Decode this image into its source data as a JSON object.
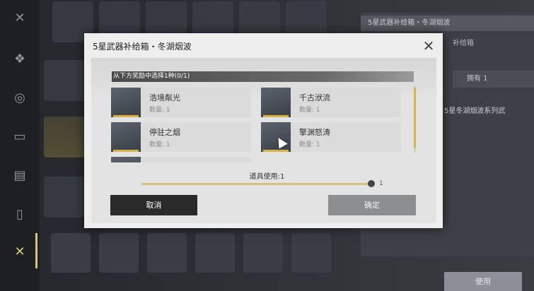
{
  "background": {
    "sidebar_icons": [
      "close-icon",
      "badge-icon",
      "ring-icon",
      "box-icon",
      "id-card-icon",
      "card-icon",
      "crossed-swords-icon"
    ],
    "right_panel": {
      "header": "5星武器补给箱・冬湖烟波",
      "sub": "补给箱",
      "own": "拥有 1",
      "desc": "5星冬湖烟波系列武",
      "use_button": "使用"
    }
  },
  "modal": {
    "title": "5星武器补给箱・冬湖烟波",
    "choose_label": "从下方奖励中选择1种(0/1)",
    "items": [
      {
        "name": "浩境粼光",
        "qty": "数量: 1"
      },
      {
        "name": "千古洑流",
        "qty": "数量: 1"
      },
      {
        "name": "停驻之烟",
        "qty": "数量: 1"
      },
      {
        "name": "擎渊怒涛",
        "qty": "数量: 1"
      }
    ],
    "use_count_label": "道具使用:1",
    "slider_max": "1",
    "slider_value_fraction": 1.0,
    "cancel_label": "取消",
    "confirm_label": "确定"
  },
  "colors": {
    "accent": "#d9b24a",
    "dark_button": "#2a2a2a",
    "disabled_button": "#8d8e90"
  }
}
